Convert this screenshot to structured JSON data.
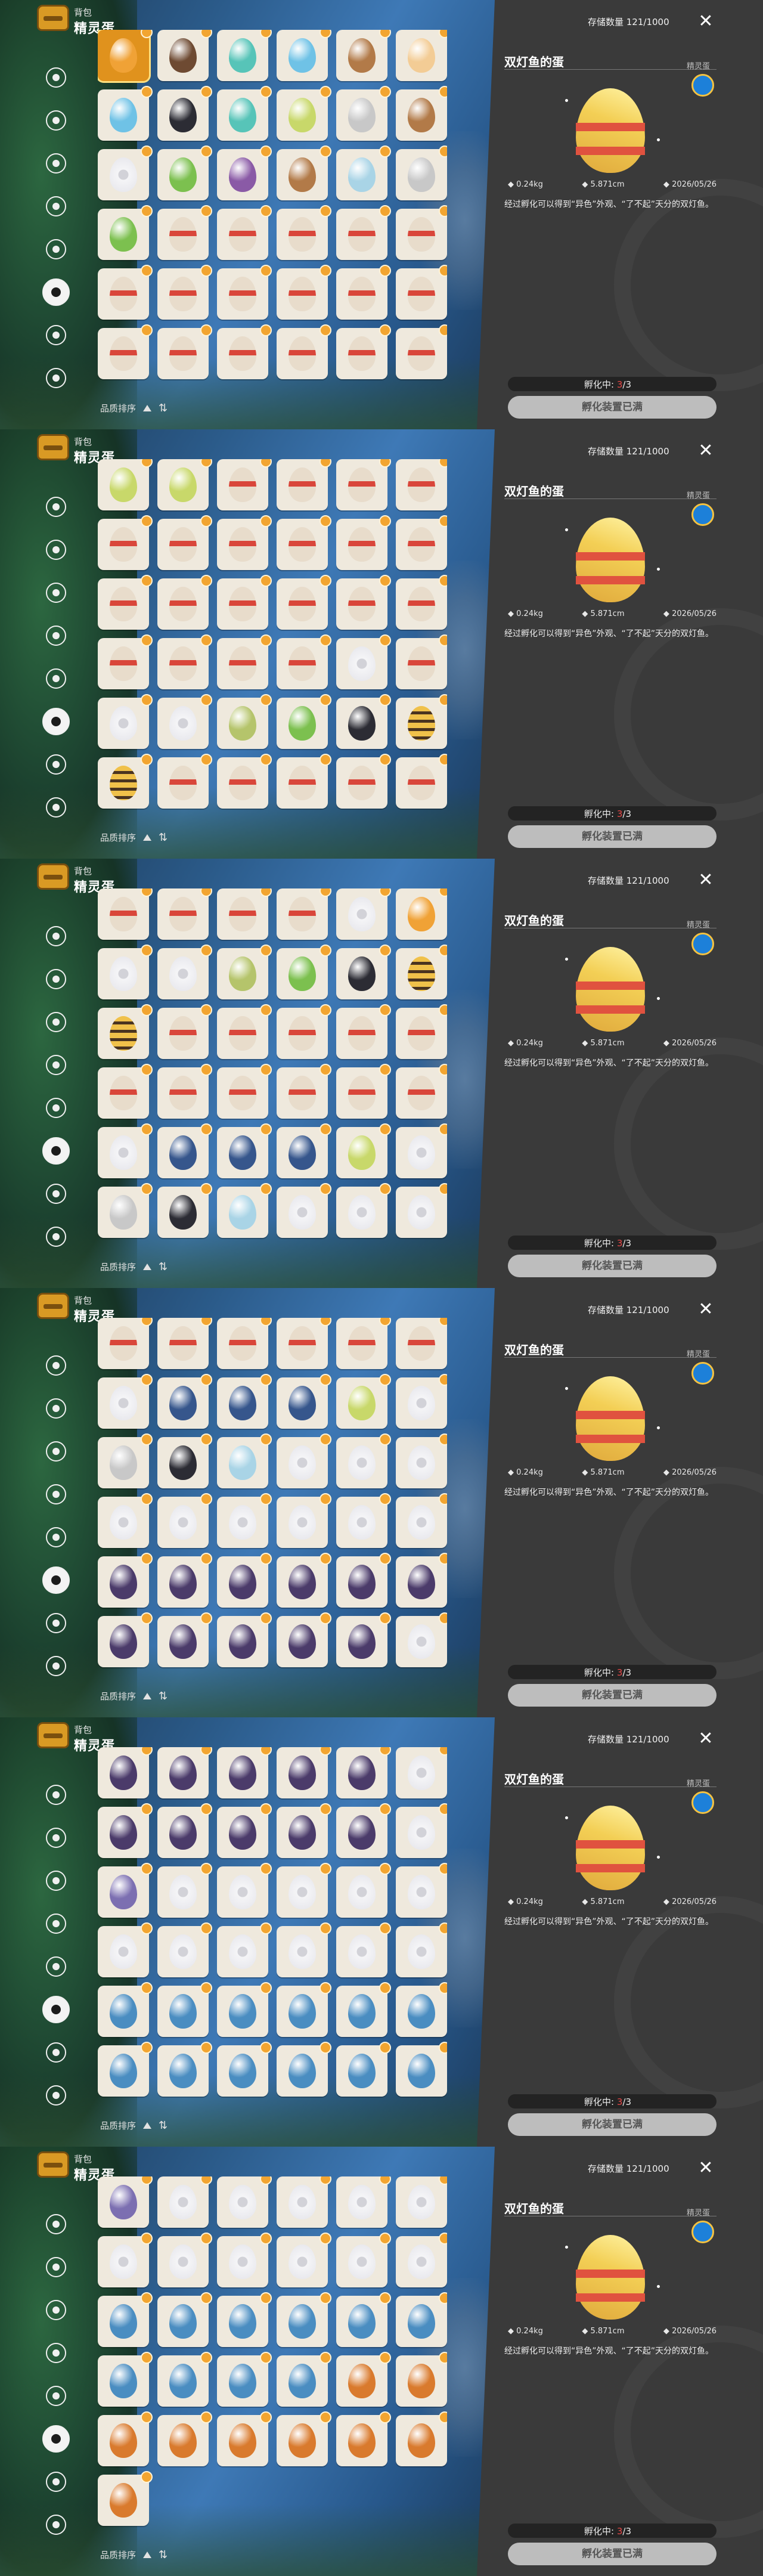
{
  "ui": {
    "bag_label": "背包",
    "category_title": "精灵蛋",
    "sort_label": "品质排序",
    "storage_text": "存储数量 121/1000",
    "close_icon": "close-icon",
    "egg_name": "双灯鱼的蛋",
    "quality": "精灵蛋",
    "weight": "0.24kg",
    "height": "5.871cm",
    "date": "2026/05/26",
    "description": "经过孵化可以得到“异色”外观、“了不起”天分的双灯鱼。",
    "hatching_label": "孵化中:",
    "hatching_current": "3",
    "hatching_total": "/3",
    "hatch_button": "孵化装置已满"
  },
  "sidebar_icons": [
    "orb-icon",
    "leaf-icon",
    "gear-flower-icon",
    "sprout-icon",
    "note-icon",
    "egg-circle-icon",
    "acorn-icon",
    "chest-icon"
  ],
  "sidebar_selected_index": 5,
  "palette": {
    "orange": "#f0a236",
    "brown": "#6e4a32",
    "teal": "#57c4b8",
    "sky": "#6fc2e6",
    "wood": "#b27a48",
    "peach": "#f3cc95",
    "cream_red": "#e8dccb",
    "gray": "#c8c8c8",
    "purple": "#8a5aa6",
    "green": "#7cc04f",
    "lime": "#c8d86a",
    "white_ring": "#e9e9ec",
    "navy": "#36568c",
    "black": "#2c2c34",
    "olive_spot": "#b5c46b",
    "striped": "#d0a13a",
    "dark_purple": "#4b3b6a",
    "violet": "#7c6fb1",
    "ice_blue": "#a9d4e6",
    "ocean": "#4a8dc1",
    "fire": "#d97a2d"
  },
  "screens": [
    {
      "rows": [
        [
          "orange",
          "brown",
          "teal",
          "sky",
          "wood",
          "peach"
        ],
        [
          "sky",
          "black",
          "teal",
          "lime",
          "gray",
          "wood"
        ],
        [
          "white_ring",
          "green",
          "purple",
          "wood",
          "ice_blue",
          "gray"
        ],
        [
          "green",
          "cream_red",
          "cream_red",
          "cream_red",
          "cream_red",
          "cream_red"
        ],
        [
          "cream_red",
          "cream_red",
          "cream_red",
          "cream_red",
          "cream_red",
          "cream_red"
        ],
        [
          "cream_red",
          "cream_red",
          "cream_red",
          "cream_red",
          "cream_red",
          "cream_red"
        ]
      ],
      "selected": [
        0,
        0
      ]
    },
    {
      "rows": [
        [
          "lime",
          "lime",
          "cream_red",
          "cream_red",
          "cream_red",
          "cream_red"
        ],
        [
          "cream_red",
          "cream_red",
          "cream_red",
          "cream_red",
          "cream_red",
          "cream_red"
        ],
        [
          "cream_red",
          "cream_red",
          "cream_red",
          "cream_red",
          "cream_red",
          "cream_red"
        ],
        [
          "cream_red",
          "cream_red",
          "cream_red",
          "cream_red",
          "white_ring",
          "cream_red"
        ],
        [
          "white_ring",
          "white_ring",
          "olive_spot",
          "green",
          "black",
          "striped"
        ],
        [
          "striped",
          "cream_red",
          "cream_red",
          "cream_red",
          "cream_red",
          "cream_red"
        ]
      ],
      "selected": null
    },
    {
      "rows": [
        [
          "cream_red",
          "cream_red",
          "cream_red",
          "cream_red",
          "white_ring",
          "orange"
        ],
        [
          "white_ring",
          "white_ring",
          "olive_spot",
          "green",
          "black",
          "striped"
        ],
        [
          "striped",
          "cream_red",
          "cream_red",
          "cream_red",
          "cream_red",
          "cream_red"
        ],
        [
          "cream_red",
          "cream_red",
          "cream_red",
          "cream_red",
          "cream_red",
          "cream_red"
        ],
        [
          "white_ring",
          "navy",
          "navy",
          "navy",
          "lime",
          "white_ring"
        ],
        [
          "gray",
          "black",
          "ice_blue",
          "white_ring",
          "white_ring",
          "white_ring"
        ]
      ],
      "selected": null
    },
    {
      "rows": [
        [
          "cream_red",
          "cream_red",
          "cream_red",
          "cream_red",
          "cream_red",
          "cream_red"
        ],
        [
          "white_ring",
          "navy",
          "navy",
          "navy",
          "lime",
          "white_ring"
        ],
        [
          "gray",
          "black",
          "ice_blue",
          "white_ring",
          "white_ring",
          "white_ring"
        ],
        [
          "white_ring",
          "white_ring",
          "white_ring",
          "white_ring",
          "white_ring",
          "white_ring"
        ],
        [
          "dark_purple",
          "dark_purple",
          "dark_purple",
          "dark_purple",
          "dark_purple",
          "dark_purple"
        ],
        [
          "dark_purple",
          "dark_purple",
          "dark_purple",
          "dark_purple",
          "dark_purple",
          "white_ring"
        ]
      ],
      "selected": null
    },
    {
      "rows": [
        [
          "dark_purple",
          "dark_purple",
          "dark_purple",
          "dark_purple",
          "dark_purple",
          "white_ring"
        ],
        [
          "dark_purple",
          "dark_purple",
          "dark_purple",
          "dark_purple",
          "dark_purple",
          "white_ring"
        ],
        [
          "violet",
          "white_ring",
          "white_ring",
          "white_ring",
          "white_ring",
          "white_ring"
        ],
        [
          "white_ring",
          "white_ring",
          "white_ring",
          "white_ring",
          "white_ring",
          "white_ring"
        ],
        [
          "ocean",
          "ocean",
          "ocean",
          "ocean",
          "ocean",
          "ocean"
        ],
        [
          "ocean",
          "ocean",
          "ocean",
          "ocean",
          "ocean",
          "ocean"
        ]
      ],
      "selected": null
    },
    {
      "rows": [
        [
          "violet",
          "white_ring",
          "white_ring",
          "white_ring",
          "white_ring",
          "white_ring"
        ],
        [
          "white_ring",
          "white_ring",
          "white_ring",
          "white_ring",
          "white_ring",
          "white_ring"
        ],
        [
          "ocean",
          "ocean",
          "ocean",
          "ocean",
          "ocean",
          "ocean"
        ],
        [
          "ocean",
          "ocean",
          "ocean",
          "ocean",
          "fire",
          "fire"
        ],
        [
          "fire",
          "fire",
          "fire",
          "fire",
          "fire",
          "fire"
        ],
        [
          "fire"
        ]
      ],
      "selected": null
    }
  ]
}
